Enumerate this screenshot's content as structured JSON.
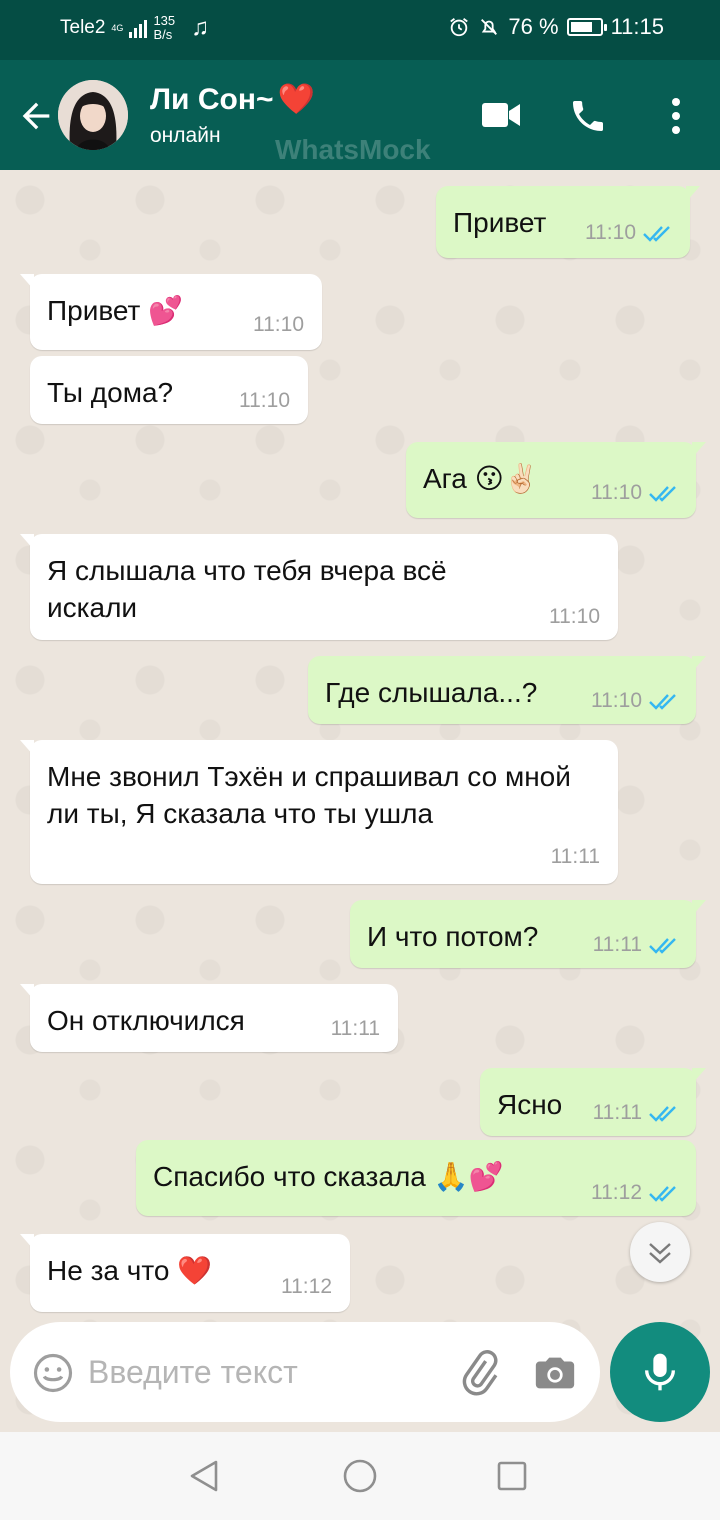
{
  "status_bar": {
    "carrier": "Tele2",
    "network": "4G",
    "speed_value": "135",
    "speed_unit": "B/s",
    "battery": "76 %",
    "battery_level": 0.76,
    "time": "11:15"
  },
  "header": {
    "contact_name": "Ли Сон~",
    "heart": "❤️",
    "status": "онлайн",
    "watermark": "WhatsMock"
  },
  "messages": [
    {
      "dir": "out",
      "text": "Привет",
      "time": "11:10"
    },
    {
      "dir": "in",
      "text": "Привет",
      "emoji": "💕",
      "time": "11:10"
    },
    {
      "dir": "in",
      "text": "Ты дома?",
      "time": "11:10"
    },
    {
      "dir": "out",
      "text": "Ага",
      "emoji": "😗✌🏻",
      "time": "11:10"
    },
    {
      "dir": "in",
      "text": "Я слышала что тебя вчера всё искали",
      "time": "11:10"
    },
    {
      "dir": "out",
      "text": "Где слышала...?",
      "time": "11:10"
    },
    {
      "dir": "in",
      "text": "Мне звонил Тэхён и спрашивал со мной ли ты, Я сказала что ты ушла",
      "time": "11:11"
    },
    {
      "dir": "out",
      "text": "И что потом?",
      "time": "11:11"
    },
    {
      "dir": "in",
      "text": "Он отключился",
      "time": "11:11"
    },
    {
      "dir": "out",
      "text": "Ясно",
      "time": "11:11"
    },
    {
      "dir": "out",
      "text": "Спасибо что сказала",
      "emoji": "🙏💕",
      "time": "11:12"
    },
    {
      "dir": "in",
      "text": "Не за что",
      "emoji": "❤️",
      "time": "11:12"
    }
  ],
  "composer": {
    "placeholder": "Введите текст"
  },
  "icons": {
    "back": "arrow-left-icon",
    "video": "video-call-icon",
    "call": "phone-icon",
    "menu": "more-vert-icon",
    "emoji": "emoji-icon",
    "attach": "paperclip-icon",
    "camera": "camera-icon",
    "mic": "mic-icon"
  },
  "colors": {
    "header": "#075e54",
    "status_bar": "#054d44",
    "chat_bg": "#ece5dd",
    "outgoing_bubble": "#dcf8c6",
    "incoming_bubble": "#ffffff",
    "read_ticks": "#34b7f1",
    "mic_button": "#128c7e"
  }
}
